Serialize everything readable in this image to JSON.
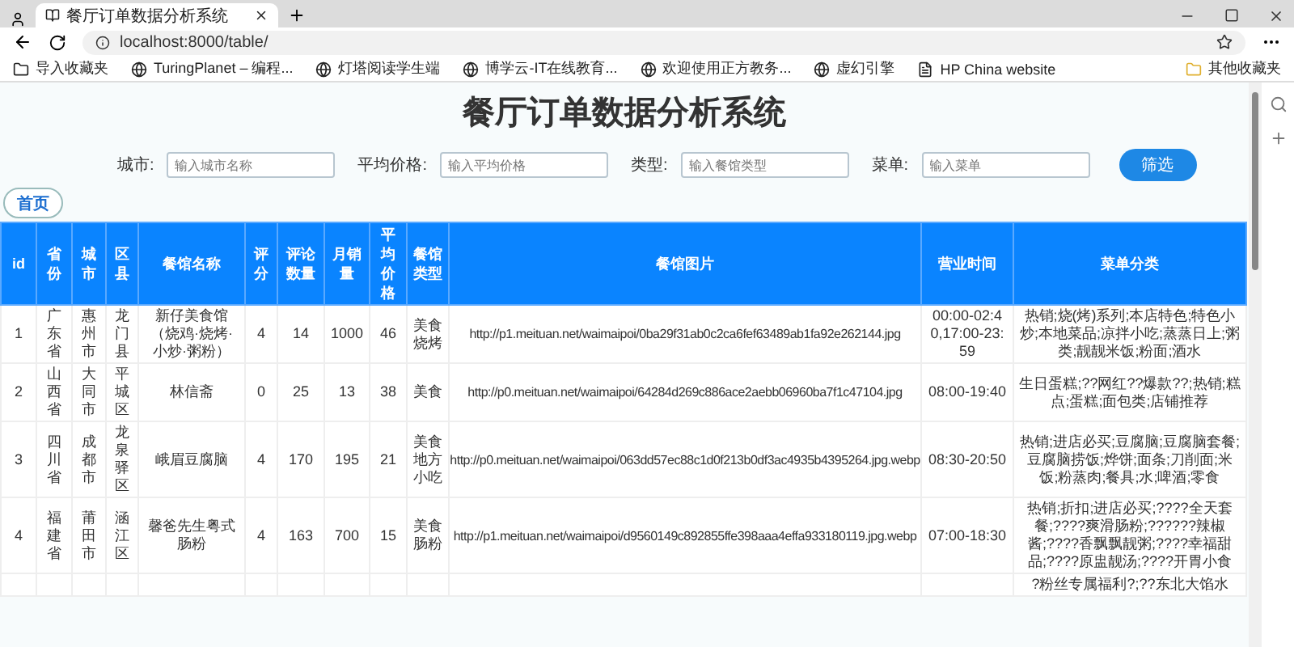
{
  "browser": {
    "tab_title": "餐厅订单数据分析系统",
    "url": "localhost:8000/table/",
    "bookmarks": [
      {
        "label": "导入收藏夹",
        "kind": "import"
      },
      {
        "label": "TuringPlanet – 编程...",
        "kind": "site"
      },
      {
        "label": "灯塔阅读学生端",
        "kind": "site"
      },
      {
        "label": "博学云-IT在线教育...",
        "kind": "site"
      },
      {
        "label": "欢迎使用正方教务...",
        "kind": "site"
      },
      {
        "label": "虚幻引擎",
        "kind": "site"
      },
      {
        "label": "HP China website",
        "kind": "page"
      }
    ],
    "other_bookmarks": "其他收藏夹"
  },
  "page": {
    "title": "餐厅订单数据分析系统",
    "filters": [
      {
        "label": "城市:",
        "placeholder": "输入城市名称"
      },
      {
        "label": "平均价格:",
        "placeholder": "输入平均价格"
      },
      {
        "label": "类型:",
        "placeholder": "输入餐馆类型"
      },
      {
        "label": "菜单:",
        "placeholder": "输入菜单"
      }
    ],
    "filter_button": "筛选",
    "home_button": "首页",
    "table": {
      "columns": [
        "id",
        "省份",
        "城市",
        "区县",
        "餐馆名称",
        "评分",
        "评论数量",
        "月销量",
        "平均价格",
        "餐馆类型",
        "餐馆图片",
        "营业时间",
        "菜单分类"
      ],
      "rows": [
        {
          "id": "1",
          "province": "广东省",
          "city": "惠州市",
          "district": "龙门县",
          "name": "新仔美食馆（烧鸡·烧烤·小炒·粥粉）",
          "rating": "4",
          "reviews": "14",
          "sales": "1000",
          "price": "46",
          "type": "美食烧烤",
          "image": "http://p1.meituan.net/waimaipoi/0ba29f31ab0c2ca6fef63489ab1fa92e262144.jpg",
          "hours": "00:00-02:40,17:00-23:59",
          "menu": "热销;烧(烤)系列;本店特色;特色小炒;本地菜品;凉拌小吃;蒸蒸日上;粥类;靓靓米饭;粉面;酒水"
        },
        {
          "id": "2",
          "province": "山西省",
          "city": "大同市",
          "district": "平城区",
          "name": "林信斋",
          "rating": "0",
          "reviews": "25",
          "sales": "13",
          "price": "38",
          "type": "美食",
          "image": "http://p0.meituan.net/waimaipoi/64284d269c886ace2aebb06960ba7f1c47104.jpg",
          "hours": "08:00-19:40",
          "menu": "生日蛋糕;??网红??爆款??;热销;糕点;蛋糕;面包类;店铺推荐"
        },
        {
          "id": "3",
          "province": "四川省",
          "city": "成都市",
          "district": "龙泉驿区",
          "name": "峨眉豆腐脑",
          "rating": "4",
          "reviews": "170",
          "sales": "195",
          "price": "21",
          "type": "美食地方小吃",
          "image": "http://p0.meituan.net/waimaipoi/063dd57ec88c1d0f213b0df3ac4935b4395264.jpg.webp",
          "hours": "08:30-20:50",
          "menu": "热销;进店必买;豆腐脑;豆腐脑套餐;豆腐脑捞饭;烨饼;面条;刀削面;米饭;粉蒸肉;餐具;水;啤酒;零食"
        },
        {
          "id": "4",
          "province": "福建省",
          "city": "莆田市",
          "district": "涵江区",
          "name": "馨爸先生粤式肠粉",
          "rating": "4",
          "reviews": "163",
          "sales": "700",
          "price": "15",
          "type": "美食肠粉",
          "image": "http://p1.meituan.net/waimaipoi/d9560149c892855ffe398aaa4effa933180119.jpg.webp",
          "hours": "07:00-18:30",
          "menu": "热销;折扣;进店必买;????全天套餐;????爽滑肠粉;??????辣椒酱;????香飘飘靓粥;????幸福甜品;????原盅靓汤;????开胃小食"
        },
        {
          "menu": "?粉丝专属福利?;??东北大馅水"
        }
      ]
    }
  }
}
